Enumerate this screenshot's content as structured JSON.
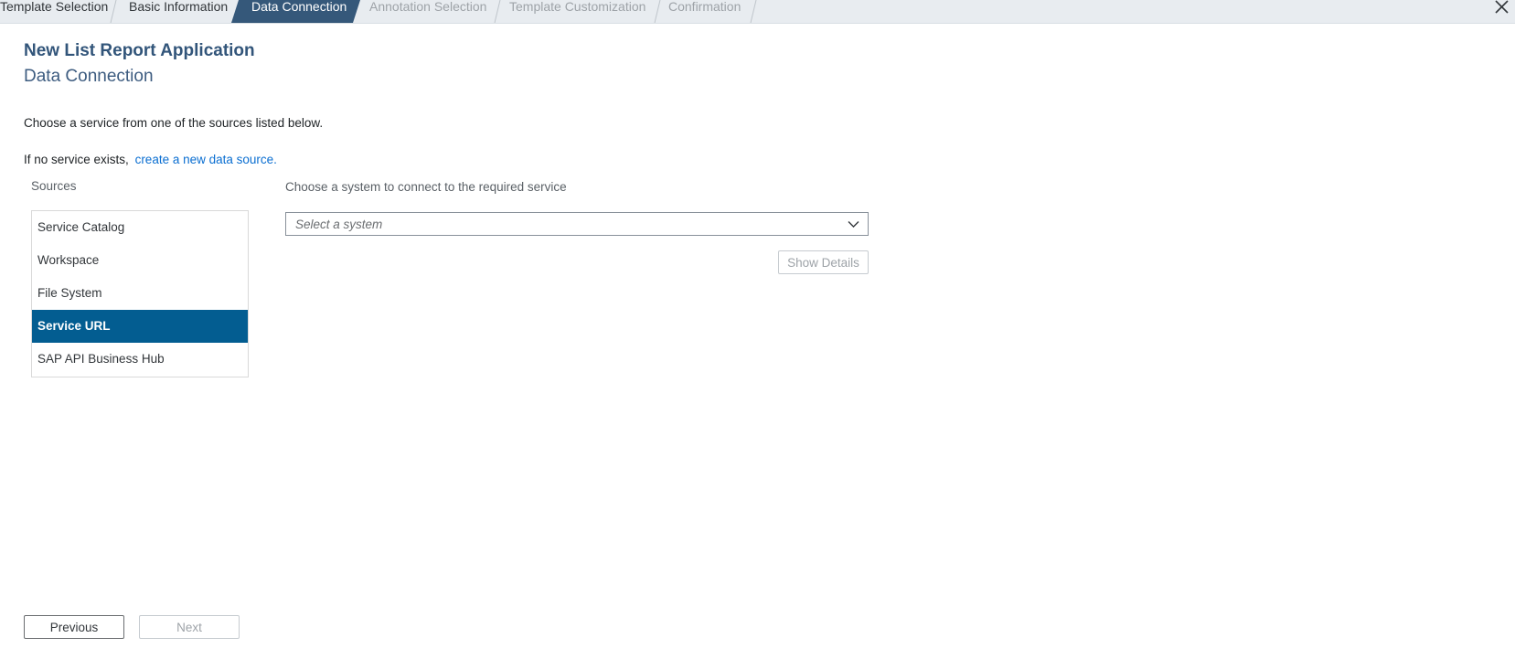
{
  "wizard": {
    "steps": [
      {
        "label": "Template Selection",
        "state": "done"
      },
      {
        "label": "Basic Information",
        "state": "done"
      },
      {
        "label": "Data Connection",
        "state": "active"
      },
      {
        "label": "Annotation Selection",
        "state": "future"
      },
      {
        "label": "Template Customization",
        "state": "future"
      },
      {
        "label": "Confirmation",
        "state": "future"
      }
    ],
    "active_color": "#35587a",
    "close_icon": "close-icon"
  },
  "header": {
    "title": "New List Report Application",
    "subtitle": "Data Connection"
  },
  "instructions": {
    "choose_service": "Choose a service from one of the sources listed below.",
    "no_service_prefix": "If no service exists,",
    "create_link": "create a new data source."
  },
  "sources": {
    "label": "Sources",
    "items": [
      {
        "label": "Service Catalog",
        "selected": false
      },
      {
        "label": "Workspace",
        "selected": false
      },
      {
        "label": "File System",
        "selected": false
      },
      {
        "label": "Service URL",
        "selected": true
      },
      {
        "label": "SAP API Business Hub",
        "selected": false
      }
    ],
    "selected_color": "#035d91"
  },
  "system": {
    "label": "Choose a system to connect to the required service",
    "placeholder": "Select a system",
    "show_details_label": "Show Details"
  },
  "footer": {
    "previous_label": "Previous",
    "next_label": "Next"
  }
}
